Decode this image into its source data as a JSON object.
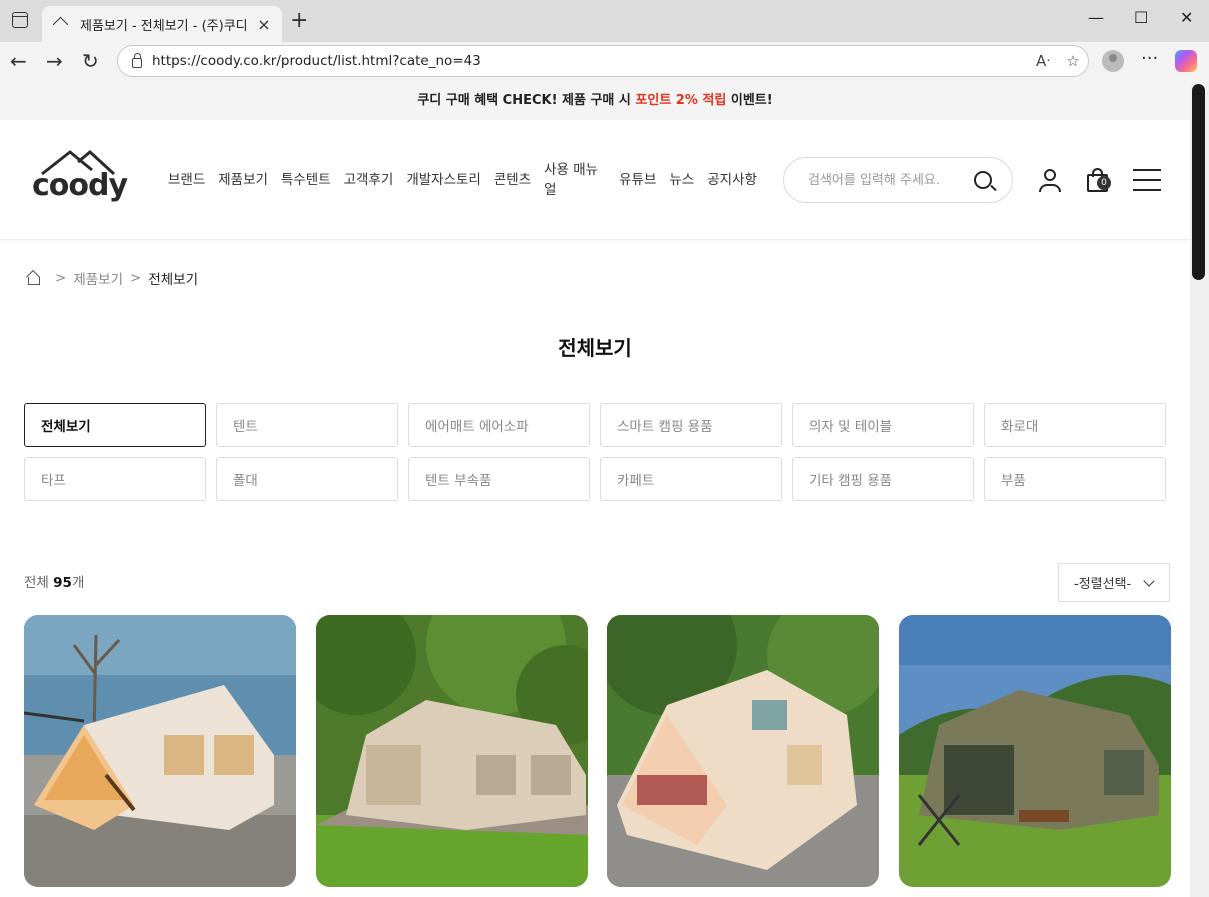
{
  "browser": {
    "tab_title": "제품보기 - 전체보기 - (주)쿠디",
    "url": "https://coody.co.kr/product/list.html?cate_no=43"
  },
  "promo": {
    "part1": "쿠디 구매 혜택 CHECK! 제품 구매 시 ",
    "highlight": "포인트 2% 적립",
    "part2": " 이벤트!",
    "highlight_color": "#e0341e"
  },
  "header": {
    "logo_text": "coody",
    "nav": [
      "브랜드",
      "제품보기",
      "특수텐트",
      "고객후기",
      "개발자스토리",
      "콘텐츠",
      "사용 매뉴얼",
      "유튜브",
      "뉴스",
      "공지사항"
    ],
    "search_placeholder": "검색어를 입력해 주세요.",
    "cart_count": "0"
  },
  "breadcrumb": {
    "parent": "제품보기",
    "current": "전체보기"
  },
  "page_title": "전체보기",
  "categories": [
    "전체보기",
    "텐트",
    "에어매트 에어소파",
    "스마트 캠핑 용품",
    "의자 및 테이블",
    "화로대",
    "타프",
    "폴대",
    "텐트 부속품",
    "카페트",
    "기타 캠핑 용품",
    "부품"
  ],
  "active_category": "전체보기",
  "product_count": {
    "label": "전체",
    "value": "95",
    "unit": "개"
  },
  "sort": {
    "selected": "-정렬선택-"
  }
}
